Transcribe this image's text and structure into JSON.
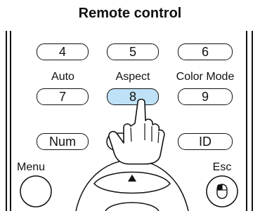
{
  "title": "Remote control",
  "keys": {
    "k4": "4",
    "k5": "5",
    "k6": "6",
    "k7": "7",
    "k8": "8",
    "k9": "9",
    "num": "Num",
    "id": "ID"
  },
  "labels": {
    "auto": "Auto",
    "aspect": "Aspect",
    "color_mode": "Color Mode",
    "menu": "Menu",
    "esc": "Esc"
  },
  "colors": {
    "highlight": "#bfe1f7",
    "outline": "#111111"
  },
  "icons": [
    "hand-pointer-icon",
    "up-arrow-icon",
    "mouse-icon"
  ]
}
